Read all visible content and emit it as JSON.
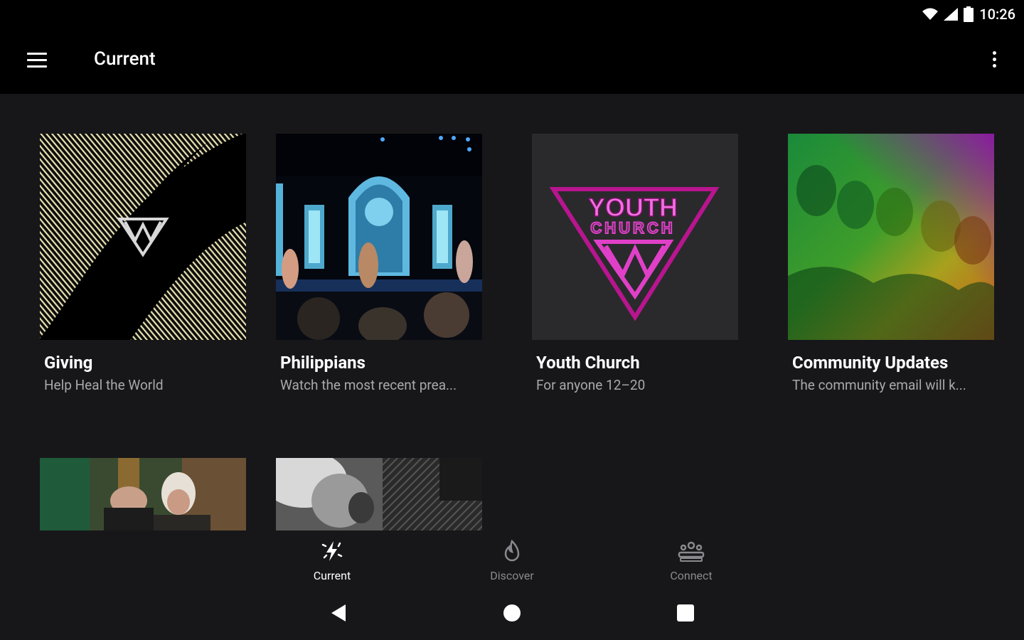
{
  "status": {
    "time": "10:26",
    "icons": [
      "wifi-icon",
      "signal-icon",
      "battery-icon"
    ]
  },
  "appbar": {
    "title": "Current",
    "menu_icon": "hamburger-menu-icon",
    "overflow_icon": "more-vert-icon"
  },
  "cards": [
    {
      "title": "Giving",
      "subtitle": "Help Heal the World"
    },
    {
      "title": "Philippians",
      "subtitle": "Watch the most recent prea..."
    },
    {
      "title": "Youth Church",
      "subtitle": "For anyone 12–20",
      "logo_line1": "YOUTH",
      "logo_line2": "CHURCH"
    },
    {
      "title": "Community Updates",
      "subtitle": "The community email will k..."
    }
  ],
  "bottom_nav": [
    {
      "label": "Current",
      "icon": "bolt-sparkle-icon",
      "active": true
    },
    {
      "label": "Discover",
      "icon": "flame-icon",
      "active": false
    },
    {
      "label": "Connect",
      "icon": "group-icon",
      "active": false
    }
  ],
  "system_nav": {
    "back_icon": "back-triangle-icon",
    "home_icon": "home-circle-icon",
    "recents_icon": "recents-square-icon"
  },
  "colors": {
    "background": "#17171a",
    "bar": "#000000",
    "accent_pink": "#e040c8",
    "active_nav": "#ffffff",
    "inactive_nav": "#8a8a8e"
  }
}
